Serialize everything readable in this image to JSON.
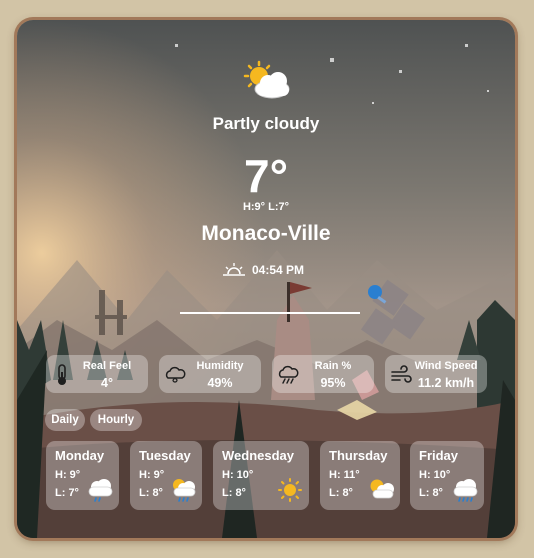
{
  "current": {
    "condition": "Partly cloudy",
    "condition_icon": "partly-cloudy-icon",
    "temperature": "7°",
    "high_low": "H:9° L:7°",
    "city": "Monaco-Ville",
    "sunset_icon": "sunset-icon",
    "sunset_time": "04:54 PM"
  },
  "stats": [
    {
      "label": "Real Feel",
      "value": "4°",
      "icon": "thermometer-icon"
    },
    {
      "label": "Humidity",
      "value": "49%",
      "icon": "humidity-icon"
    },
    {
      "label": "Rain %",
      "value": "95%",
      "icon": "rain-cloud-icon"
    },
    {
      "label": "Wind Speed",
      "value": "11.2 km/h",
      "icon": "wind-icon"
    }
  ],
  "tabs": {
    "daily": "Daily",
    "hourly": "Hourly"
  },
  "forecast": [
    {
      "day": "Monday",
      "high": "H: 9°",
      "low": "L: 7°",
      "icon": "rain-cloud-icon"
    },
    {
      "day": "Tuesday",
      "high": "H: 9°",
      "low": "L: 8°",
      "icon": "sun-cloud-rain-icon"
    },
    {
      "day": "Wednesday",
      "high": "H: 10°",
      "low": "L: 8°",
      "icon": "sun-icon"
    },
    {
      "day": "Thursday",
      "high": "H: 11°",
      "low": "L: 8°",
      "icon": "partly-cloudy-icon"
    },
    {
      "day": "Friday",
      "high": "H: 10°",
      "low": "L: 8°",
      "icon": "rain-cloud-icon"
    }
  ]
}
